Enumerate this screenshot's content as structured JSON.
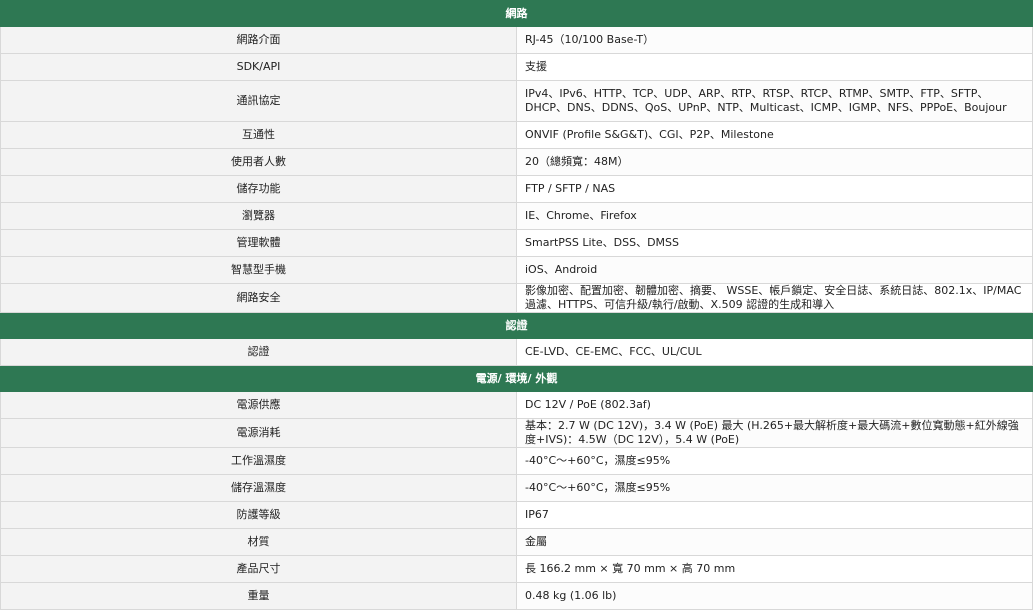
{
  "sections": [
    {
      "title": "網路",
      "rows": [
        {
          "label": "網路介面",
          "value": "RJ-45（10/100 Base-T）"
        },
        {
          "label": "SDK/API",
          "value": "支援"
        },
        {
          "label": "通訊協定",
          "value": "IPv4、IPv6、HTTP、TCP、UDP、ARP、RTP、RTSP、RTCP、RTMP、SMTP、FTP、SFTP、DHCP、DNS、DDNS、QoS、UPnP、NTP、Multicast、ICMP、IGMP、NFS、PPPoE、Boujour"
        },
        {
          "label": "互通性",
          "value": "ONVIF (Profile S&G&T)、CGI、P2P、Milestone"
        },
        {
          "label": "使用者人數",
          "value": "20（總頻寬：48M）"
        },
        {
          "label": "儲存功能",
          "value": "FTP / SFTP / NAS"
        },
        {
          "label": "瀏覽器",
          "value": "IE、Chrome、Firefox"
        },
        {
          "label": "管理軟體",
          "value": "SmartPSS Lite、DSS、DMSS"
        },
        {
          "label": "智慧型手機",
          "value": "iOS、Android"
        },
        {
          "label": "網路安全",
          "value": "影像加密、配置加密、韌體加密、摘要、 WSSE、帳戶鎖定、安全日誌、系統日誌、802.1x、IP/MAC 過濾、HTTPS、可信升級/執行/啟動、X.509 認證的生成和導入"
        }
      ]
    },
    {
      "title": "認證",
      "rows": [
        {
          "label": "認證",
          "value": "CE-LVD、CE-EMC、FCC、UL/CUL"
        }
      ]
    },
    {
      "title": "電源/ 環境/ 外觀",
      "rows": [
        {
          "label": "電源供應",
          "value": "DC 12V / PoE (802.3af)"
        },
        {
          "label": "電源消耗",
          "value": "基本：2.7 W (DC 12V)，3.4 W (PoE) 最大 (H.265+最大解析度+最大碼流+數位寬動態+紅外線強度+IVS)：4.5W（DC 12V），5.4 W (PoE)"
        },
        {
          "label": "工作溫濕度",
          "value": "-40°C～+60°C，濕度≤95%"
        },
        {
          "label": "儲存溫濕度",
          "value": "-40°C～+60°C，濕度≤95%"
        },
        {
          "label": "防護等級",
          "value": "IP67"
        },
        {
          "label": "材質",
          "value": "金屬"
        },
        {
          "label": "產品尺寸",
          "value": "長 166.2 mm × 寬 70 mm × 高 70 mm"
        },
        {
          "label": "重量",
          "value": "0.48 kg (1.06 lb)"
        }
      ]
    }
  ]
}
